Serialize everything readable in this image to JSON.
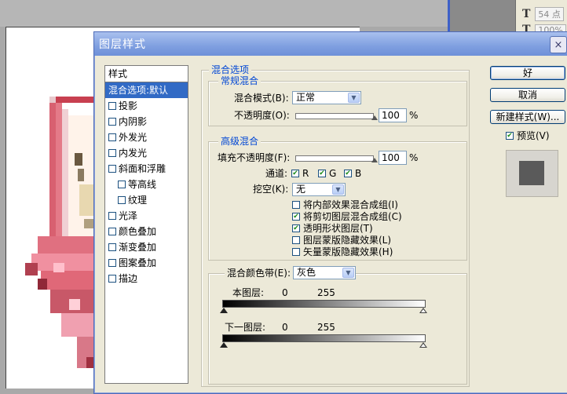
{
  "options_bar": {
    "font_size": "54 点",
    "scale": "100%"
  },
  "dialog": {
    "title": "图层样式",
    "close_label": "×",
    "styles_header": "样式",
    "style_items": [
      {
        "label": "混合选项:默认",
        "checkbox": false,
        "selected": true,
        "indent": false
      },
      {
        "label": "投影",
        "checkbox": true,
        "selected": false,
        "indent": false
      },
      {
        "label": "内阴影",
        "checkbox": true,
        "selected": false,
        "indent": false
      },
      {
        "label": "外发光",
        "checkbox": true,
        "selected": false,
        "indent": false
      },
      {
        "label": "内发光",
        "checkbox": true,
        "selected": false,
        "indent": false
      },
      {
        "label": "斜面和浮雕",
        "checkbox": true,
        "selected": false,
        "indent": false
      },
      {
        "label": "等高线",
        "checkbox": true,
        "selected": false,
        "indent": true
      },
      {
        "label": "纹理",
        "checkbox": true,
        "selected": false,
        "indent": true
      },
      {
        "label": "光泽",
        "checkbox": true,
        "selected": false,
        "indent": false
      },
      {
        "label": "颜色叠加",
        "checkbox": true,
        "selected": false,
        "indent": false
      },
      {
        "label": "渐变叠加",
        "checkbox": true,
        "selected": false,
        "indent": false
      },
      {
        "label": "图案叠加",
        "checkbox": true,
        "selected": false,
        "indent": false
      },
      {
        "label": "描边",
        "checkbox": true,
        "selected": false,
        "indent": false
      }
    ],
    "blend_options_title": "混合选项",
    "general": {
      "title": "常规混合",
      "mode_label": "混合模式(B):",
      "mode_value": "正常",
      "opacity_label": "不透明度(O):",
      "opacity_value": "100",
      "opacity_percent": 100,
      "unit": "%"
    },
    "advanced": {
      "title": "高级混合",
      "fill_label": "填充不透明度(F):",
      "fill_value": "100",
      "fill_percent": 100,
      "unit": "%",
      "channels_label": "通道:",
      "channels": [
        {
          "label": "R",
          "checked": true
        },
        {
          "label": "G",
          "checked": true
        },
        {
          "label": "B",
          "checked": true
        }
      ],
      "knockout_label": "挖空(K):",
      "knockout_value": "无",
      "options": [
        {
          "label": "将内部效果混合成组(I)",
          "checked": false
        },
        {
          "label": "将剪切图层混合成组(C)",
          "checked": true
        },
        {
          "label": "透明形状图层(T)",
          "checked": true
        },
        {
          "label": "图层蒙版隐藏效果(L)",
          "checked": false
        },
        {
          "label": "矢量蒙版隐藏效果(H)",
          "checked": false
        }
      ]
    },
    "blend_if": {
      "label": "混合颜色带(E):",
      "value": "灰色",
      "this_layer_label": "本图层:",
      "this_low": "0",
      "this_high": "255",
      "under_layer_label": "下一图层:",
      "under_low": "0",
      "under_high": "255"
    },
    "buttons": {
      "ok": "好",
      "cancel": "取消",
      "new_style": "新建样式(W)..."
    },
    "preview": {
      "label": "预览(V)",
      "checked": true
    }
  }
}
